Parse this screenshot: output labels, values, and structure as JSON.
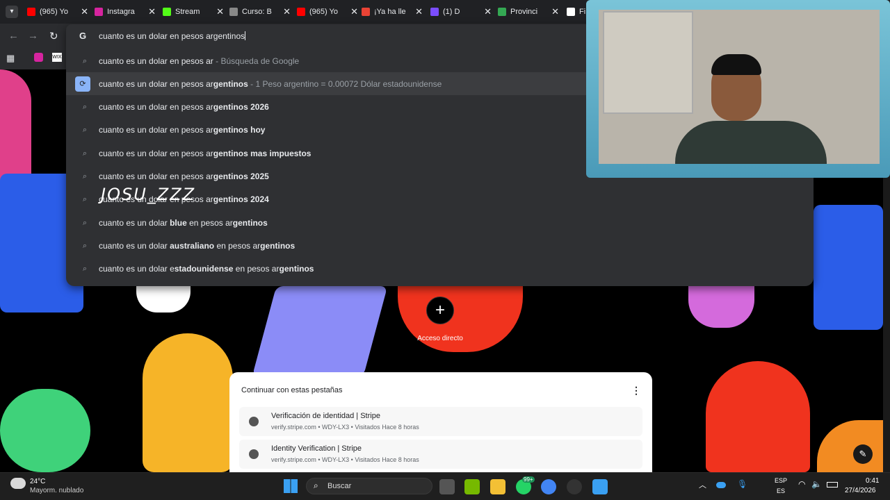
{
  "tabs": [
    {
      "label": "(965) Yo",
      "icon": "youtube-icon",
      "color": "#ff0000"
    },
    {
      "label": "Instagra",
      "icon": "instagram-icon",
      "color": "#d6249f"
    },
    {
      "label": "Stream",
      "icon": "kick-icon",
      "color": "#53fc18"
    },
    {
      "label": "Curso: B",
      "icon": "course-icon",
      "color": "#888888"
    },
    {
      "label": "(965) Yo",
      "icon": "youtube-icon",
      "color": "#ff0000"
    },
    {
      "label": "¡Ya ha lle",
      "icon": "gmail-icon",
      "color": "#ea4335"
    },
    {
      "label": "(1) D",
      "icon": "app-icon",
      "color": "#7b4dff"
    },
    {
      "label": "Provinci",
      "icon": "maps-icon",
      "color": "#34a853"
    },
    {
      "label": "Fi",
      "icon": "wikipedia-icon",
      "color": "#ffffff"
    }
  ],
  "omnibox": {
    "input": "cuanto es un dolar en pesos argentinos",
    "suggestions": [
      {
        "pre": "cuanto es un dolar en pesos ar",
        "bold": "",
        "post": "",
        "sub": " - Búsqueda de Google",
        "icon": "search-icon"
      },
      {
        "pre": "cuanto es un dolar en pesos ar",
        "bold": "gentinos",
        "post": "",
        "sub": " - 1 Peso argentino = 0.00072 Dólar estadounidense",
        "icon": "currency-convert-icon",
        "selected": true
      },
      {
        "pre": "cuanto es un dolar en pesos ar",
        "bold": "gentinos 2026",
        "post": "",
        "sub": "",
        "icon": "search-icon"
      },
      {
        "pre": "cuanto es un dolar en pesos ar",
        "bold": "gentinos hoy",
        "post": "",
        "sub": "",
        "icon": "search-icon"
      },
      {
        "pre": "cuanto es un dolar en pesos ar",
        "bold": "gentinos mas impuestos",
        "post": "",
        "sub": "",
        "icon": "search-icon"
      },
      {
        "pre": "cuanto es un dolar en pesos ar",
        "bold": "gentinos 2025",
        "post": "",
        "sub": "",
        "icon": "search-icon"
      },
      {
        "pre": "cuanto es un dolar en pesos ar",
        "bold": "gentinos 2024",
        "post": "",
        "sub": "",
        "icon": "search-icon"
      },
      {
        "pre": "cuanto es un dolar ",
        "bold": "blue",
        "post": " en pesos ar",
        "bold2": "gentinos",
        "sub": "",
        "icon": "search-icon"
      },
      {
        "pre": "cuanto es un dolar ",
        "bold": "australiano",
        "post": " en pesos ar",
        "bold2": "gentinos",
        "sub": "",
        "icon": "search-icon"
      },
      {
        "pre": "cuanto es un dolar e",
        "bold": "stadounidense",
        "post": " en pesos ar",
        "bold2": "gentinos",
        "sub": "",
        "icon": "search-icon"
      }
    ]
  },
  "watermark": "JOSU_ZZZ",
  "shortcut": {
    "label": "Acceso directo",
    "icon": "plus-icon"
  },
  "continue": {
    "title": "Continuar con estas pestañas",
    "items": [
      {
        "title": "Verificación de identidad | Stripe",
        "meta": "verify.stripe.com • WDY-LX3 • Visitados Hace 8 horas"
      },
      {
        "title": "Identity Verification | Stripe",
        "meta": "verify.stripe.com • WDY-LX3 • Visitados Hace 8 horas"
      }
    ]
  },
  "taskbar": {
    "weather_temp": "24°C",
    "weather_desc": "Mayorm. nublado",
    "search": "Buscar",
    "lang1": "ESP",
    "lang2": "ES",
    "time": "0:41",
    "date": "27/4/2026",
    "badge": "99+"
  },
  "colors": {
    "accent": "#8ab4f8"
  }
}
